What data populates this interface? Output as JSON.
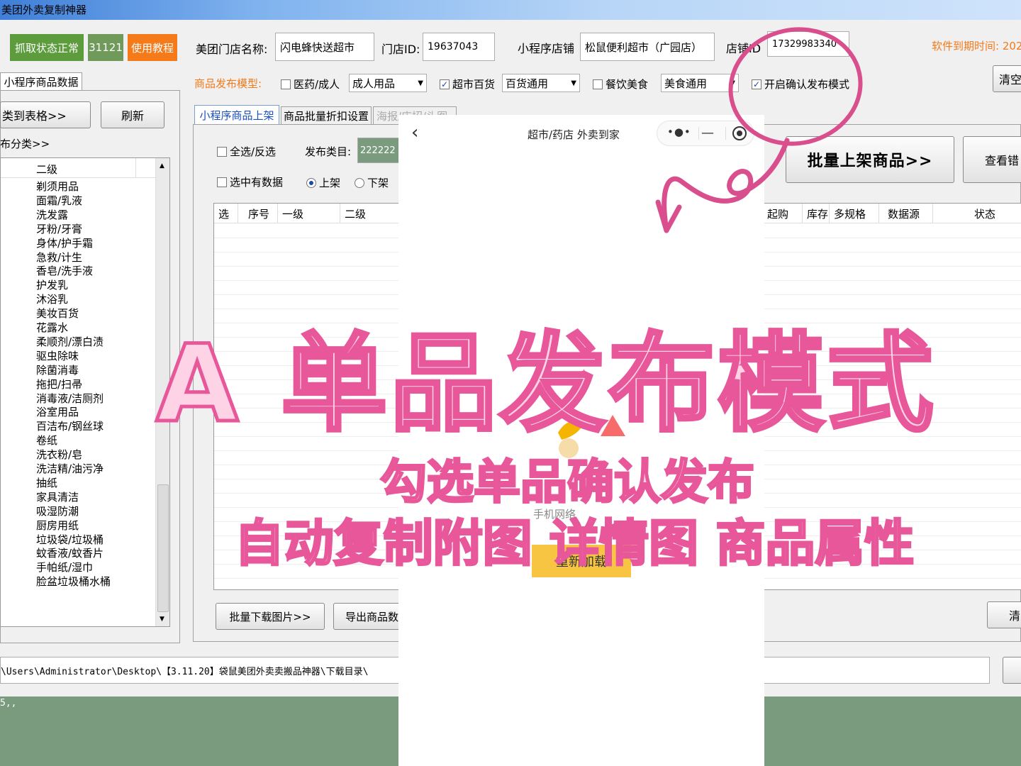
{
  "window": {
    "title": "美团外卖复制神器"
  },
  "toolbar": {
    "status_button": "抓取状态正常",
    "count_badge": "31121",
    "tutorial_button": "使用教程",
    "store_name_label": "美团门店名称:",
    "store_name_value": "闪电蜂快送超市",
    "store_id_label": "门店ID:",
    "store_id_value": "19637043",
    "mini_store_label": "小程序店铺",
    "mini_store_value": "松鼠便利超市（广园店）",
    "shop_id_label": "店铺ID",
    "shop_id_value": "17329983340",
    "expiry_label": "软件到期时间: 202",
    "clear_button": "清空"
  },
  "publish_model": {
    "label": "商品发布模型:",
    "options": [
      {
        "label": "医药/成人",
        "checked": false,
        "combo": "成人用品"
      },
      {
        "label": "超市百货",
        "checked": true,
        "combo": "百货通用"
      },
      {
        "label": "餐饮美食",
        "checked": false,
        "combo": "美食通用"
      }
    ],
    "confirm_mode": {
      "label": "开启确认发布模式",
      "checked": true
    }
  },
  "left_panel": {
    "tab": "小程序商品数据",
    "to_table_button": "类到表格>>",
    "refresh_button": "刷新",
    "section_label": "布分类>>",
    "column_header": "二级",
    "categories": [
      "剃须用品",
      "面霜/乳液",
      "洗发露",
      "牙粉/牙膏",
      "身体/护手霜",
      "急救/计生",
      "香皂/洗手液",
      "护发乳",
      "沐浴乳",
      "美妆百货",
      "花露水",
      "柔顺剂/漂白渍",
      "驱虫除味",
      "除菌消毒",
      "拖把/扫帚",
      "消毒液/洁厕剂",
      "浴室用品",
      "百洁布/钢丝球",
      "卷纸",
      "洗衣粉/皂",
      "洗洁精/油污净",
      "抽纸",
      "家具清洁",
      "吸湿防潮",
      "厨房用纸",
      "垃圾袋/垃圾桶",
      "蚊香液/蚊香片",
      "手帕纸/湿巾",
      "脸盆垃圾桶水桶"
    ]
  },
  "main_tabs": [
    {
      "label": "小程序商品上架",
      "active": true
    },
    {
      "label": "商品批量折扣设置",
      "active": false
    },
    {
      "label": "海报/店招/头图",
      "active": false
    }
  ],
  "main": {
    "select_all": "全选/反选",
    "publish_category_label": "发布类目:",
    "publish_category_value": "222222",
    "selected_has_data": "选中有数据",
    "radio_on": "上架",
    "radio_off": "下架",
    "batch_list_button": "批量上架商品>>",
    "check_error_button": "查看错",
    "table_headers_left": [
      "选",
      "序号",
      "一级",
      "二级"
    ],
    "table_headers_right": [
      "起购",
      "库存",
      "多规格",
      "数据源",
      "状态"
    ],
    "download_images_button": "批量下载图片>>",
    "export_button": "导出商品数",
    "right_bottom_button": "清"
  },
  "footer": {
    "path": "\\Users\\Administrator\\Desktop\\【3.11.20】袋鼠美团外卖卖搬品神器\\下载目录\\",
    "log": "5,,"
  },
  "miniprogram": {
    "title": "超市/药店 外卖到家",
    "network_hint": "手机网络",
    "reload_button": "重新加载"
  },
  "overlay": {
    "headline": "A 单品发布模式",
    "line1": "勾选单品确认发布",
    "line2": "自动复制附图 详情图 商品属性"
  },
  "colors": {
    "accent_orange": "#f47a1a",
    "status_green": "#5c9c3d",
    "overlay_pink": "#e8579a",
    "log_bg": "#7b9b7f"
  }
}
